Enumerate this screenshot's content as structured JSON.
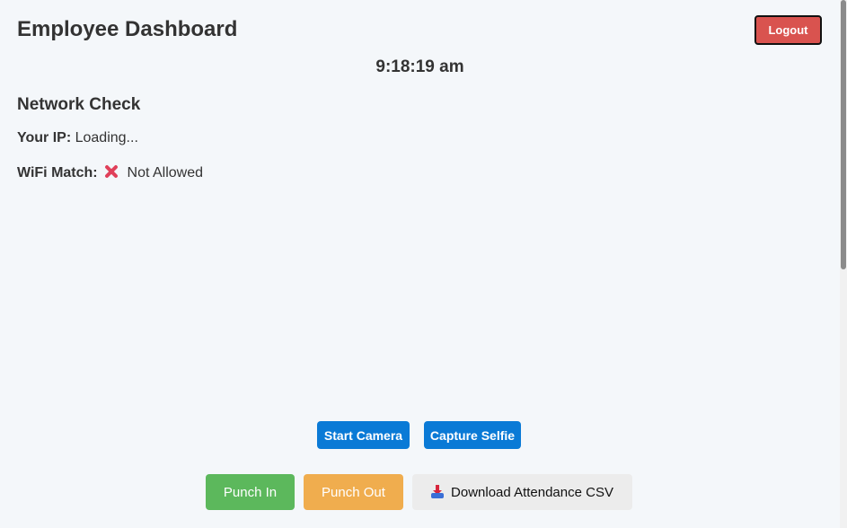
{
  "header": {
    "title": "Employee Dashboard",
    "logout_label": "Logout"
  },
  "clock": {
    "time": "9:18:19 am"
  },
  "network": {
    "section_title": "Network Check",
    "ip_label": "Your IP:",
    "ip_value": "Loading...",
    "wifi_label": "WiFi Match:",
    "wifi_icon": "cross-mark-icon",
    "wifi_value": "Not Allowed"
  },
  "camera": {
    "start_label": "Start Camera",
    "capture_label": "Capture Selfie"
  },
  "actions": {
    "punch_in_label": "Punch In",
    "punch_out_label": "Punch Out",
    "download_icon": "download-tray-icon",
    "download_label": "Download Attendance CSV"
  },
  "colors": {
    "logout": "#d9534f",
    "primary": "#0a7ad6",
    "punch_in": "#5cb85c",
    "punch_out": "#f0ad4e",
    "download_bg": "#ececec",
    "page_bg": "#f4f7fa"
  }
}
